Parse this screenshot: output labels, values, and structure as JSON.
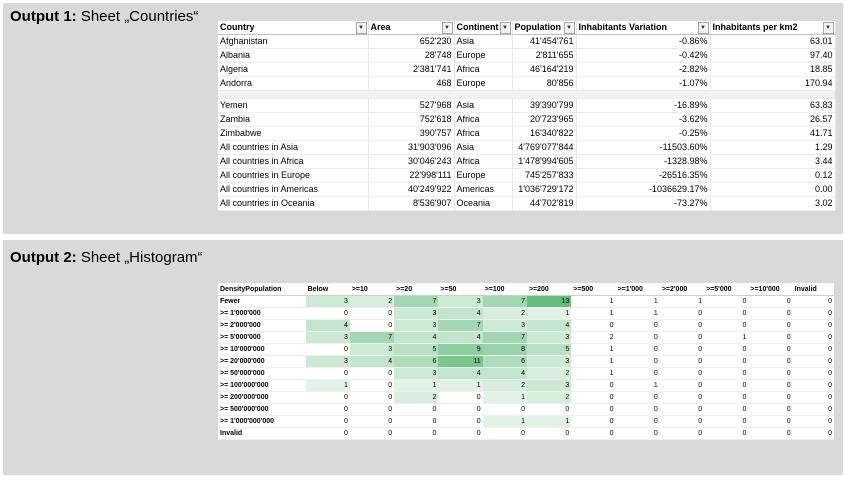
{
  "output1": {
    "title_bold": "Output 1:",
    "title_rest": " Sheet „Countries“",
    "headers": [
      "Country",
      "Area",
      "Continent",
      "Population",
      "Inhabitants Variation",
      "Inhabitants per km2"
    ],
    "rows_top": [
      [
        "Afghanistan",
        "652'230",
        "Asia",
        "41'454'761",
        "-0.86%",
        "63.01"
      ],
      [
        "Albania",
        "28'748",
        "Europe",
        "2'811'655",
        "-0.42%",
        "97.40"
      ],
      [
        "Algeria",
        "2'381'741",
        "Africa",
        "46'164'219",
        "-2.82%",
        "18.85"
      ],
      [
        "Andorra",
        "468",
        "Europe",
        "80'856",
        "-1.07%",
        "170.94"
      ]
    ],
    "rows_bottom": [
      [
        "Yemen",
        "527'968",
        "Asia",
        "39'390'799",
        "-16.89%",
        "63.83"
      ],
      [
        "Zambia",
        "752'618",
        "Africa",
        "20'723'965",
        "-3.62%",
        "26.57"
      ],
      [
        "Zimbabwe",
        "390'757",
        "Africa",
        "16'340'822",
        "-0.25%",
        "41.71"
      ],
      [
        "All countries in Asia",
        "31'903'096",
        "Asia",
        "4'769'077'844",
        "-11503.60%",
        "1.29"
      ],
      [
        "All countries in Africa",
        "30'046'243",
        "Africa",
        "1'478'994'605",
        "-1328.98%",
        "3.44"
      ],
      [
        "All countries in Europe",
        "22'998'111",
        "Europe",
        "745'257'833",
        "-26516.35%",
        "0.12"
      ],
      [
        "All countries in Americas",
        "40'249'922",
        "Americas",
        "1'036'729'172",
        "-1036629.17%",
        "0.00"
      ],
      [
        "All countries in Oceania",
        "8'536'907",
        "Oceania",
        "44'702'819",
        "-73.27%",
        "3.02"
      ]
    ]
  },
  "output2": {
    "title_bold": "Output 2:",
    "title_rest": " Sheet „Histogram“",
    "heat_color": "#63be7b",
    "headers": [
      "DensityPopulation",
      "Below",
      ">=10",
      ">=20",
      ">=50",
      ">=100",
      ">=200",
      ">=500",
      ">=1'000",
      ">=2'000",
      ">=5'000",
      ">=10'000",
      "Invalid"
    ],
    "rows": [
      {
        "label": "Fewer",
        "values": [
          3,
          2,
          7,
          3,
          7,
          13,
          1,
          1,
          1,
          0,
          0,
          0
        ]
      },
      {
        "label": ">= 1'000'000",
        "values": [
          0,
          0,
          3,
          4,
          2,
          1,
          1,
          1,
          0,
          0,
          0,
          0
        ]
      },
      {
        "label": ">= 2'000'000",
        "values": [
          4,
          0,
          3,
          7,
          3,
          4,
          0,
          0,
          0,
          0,
          0,
          0
        ]
      },
      {
        "label": ">= 5'000'000",
        "values": [
          3,
          7,
          4,
          4,
          7,
          3,
          2,
          0,
          0,
          1,
          0,
          0
        ]
      },
      {
        "label": ">= 10'000'000",
        "values": [
          0,
          3,
          5,
          9,
          8,
          5,
          1,
          0,
          0,
          0,
          0,
          0
        ]
      },
      {
        "label": ">= 20'000'000",
        "values": [
          3,
          4,
          6,
          11,
          6,
          3,
          1,
          0,
          0,
          0,
          0,
          0
        ]
      },
      {
        "label": ">= 50'000'000",
        "values": [
          0,
          0,
          3,
          4,
          4,
          2,
          1,
          0,
          0,
          0,
          0,
          0
        ]
      },
      {
        "label": ">= 100'000'000",
        "values": [
          1,
          0,
          1,
          1,
          2,
          3,
          0,
          1,
          0,
          0,
          0,
          0
        ]
      },
      {
        "label": ">= 200'000'000",
        "values": [
          0,
          0,
          2,
          0,
          1,
          2,
          0,
          0,
          0,
          0,
          0,
          0
        ]
      },
      {
        "label": ">= 500'000'000",
        "values": [
          0,
          0,
          0,
          0,
          0,
          0,
          0,
          0,
          0,
          0,
          0,
          0
        ]
      },
      {
        "label": ">= 1'000'000'000",
        "values": [
          0,
          0,
          0,
          0,
          1,
          1,
          0,
          0,
          0,
          0,
          0,
          0
        ]
      },
      {
        "label": "Invalid",
        "values": [
          0,
          0,
          0,
          0,
          0,
          0,
          0,
          0,
          0,
          0,
          0,
          0
        ]
      }
    ]
  }
}
